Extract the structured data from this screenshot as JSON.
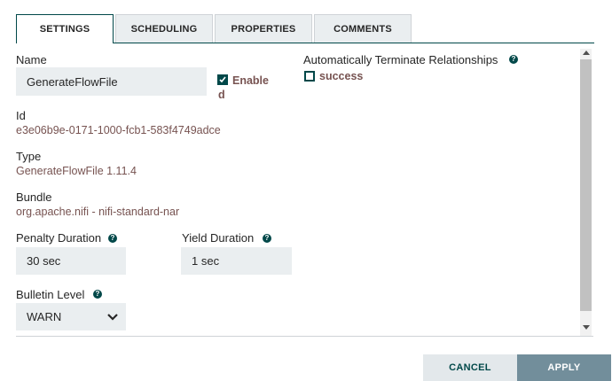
{
  "tabs": [
    {
      "label": "SETTINGS",
      "active": true
    },
    {
      "label": "SCHEDULING",
      "active": false
    },
    {
      "label": "PROPERTIES",
      "active": false
    },
    {
      "label": "COMMENTS",
      "active": false
    }
  ],
  "settings": {
    "name_label": "Name",
    "name_value": "GenerateFlowFile",
    "enabled_label_line1": "Enable",
    "enabled_label_line2": "d",
    "enabled_checked": true,
    "id_label": "Id",
    "id_value": "e3e06b9e-0171-1000-fcb1-583f4749adce",
    "type_label": "Type",
    "type_value": "GenerateFlowFile 1.11.4",
    "bundle_label": "Bundle",
    "bundle_value": "org.apache.nifi - nifi-standard-nar",
    "penalty_label": "Penalty Duration",
    "penalty_value": "30 sec",
    "yield_label": "Yield Duration",
    "yield_value": "1 sec",
    "bulletin_label": "Bulletin Level",
    "bulletin_value": "WARN",
    "auto_terminate_label": "Automatically Terminate Relationships",
    "relationships": [
      {
        "label": "success",
        "checked": false
      }
    ]
  },
  "icons": {
    "help": "question-circle-icon",
    "dropdown": "chevron-down-icon",
    "scroll_up": "scroll-up-arrow-icon",
    "scroll_down": "scroll-down-arrow-icon"
  },
  "footer": {
    "cancel_label": "CANCEL",
    "apply_label": "APPLY"
  },
  "colors": {
    "accent": "#004849",
    "value_text": "#775351",
    "field_bg": "#eaeef0",
    "apply_bg": "#728e9b",
    "cancel_bg": "#e3e8eb"
  }
}
